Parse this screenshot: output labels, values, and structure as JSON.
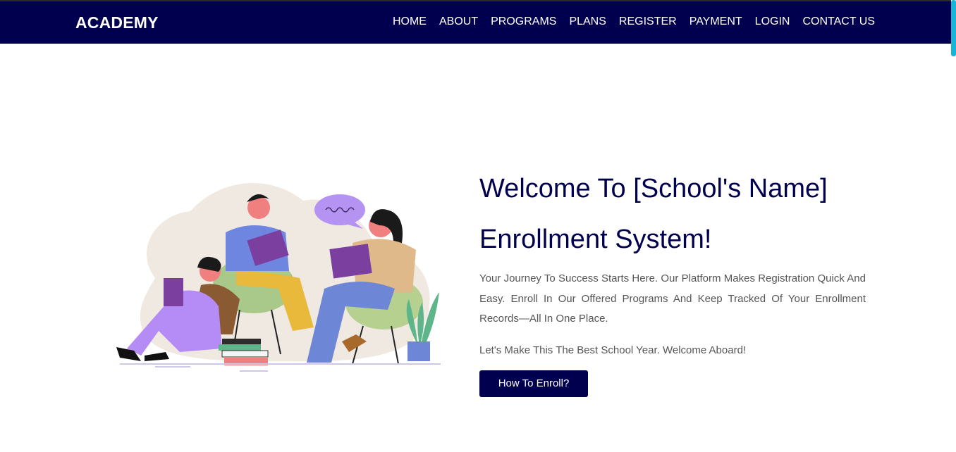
{
  "brand": "ACADEMY",
  "nav": {
    "items": [
      {
        "label": "HOME"
      },
      {
        "label": "ABOUT"
      },
      {
        "label": "PROGRAMS"
      },
      {
        "label": "PLANS"
      },
      {
        "label": "REGISTER"
      },
      {
        "label": "PAYMENT"
      },
      {
        "label": "LOGIN"
      },
      {
        "label": "CONTACT US"
      }
    ]
  },
  "hero": {
    "title": "Welcome To [School's Name] Enrollment System!",
    "description": "Your Journey To Success Starts Here. Our Platform Makes Registration Quick And Easy. Enroll In Our Offered Programs And Keep Tracked Of Your Enrollment Records—All In One Place.",
    "tagline": "Let's Make This The Best School Year. Welcome Aboard!",
    "button_label": "How To Enroll?"
  },
  "colors": {
    "navbar": "#00004f",
    "accent": "#00004f",
    "scrollbar": "#14b8d6"
  }
}
